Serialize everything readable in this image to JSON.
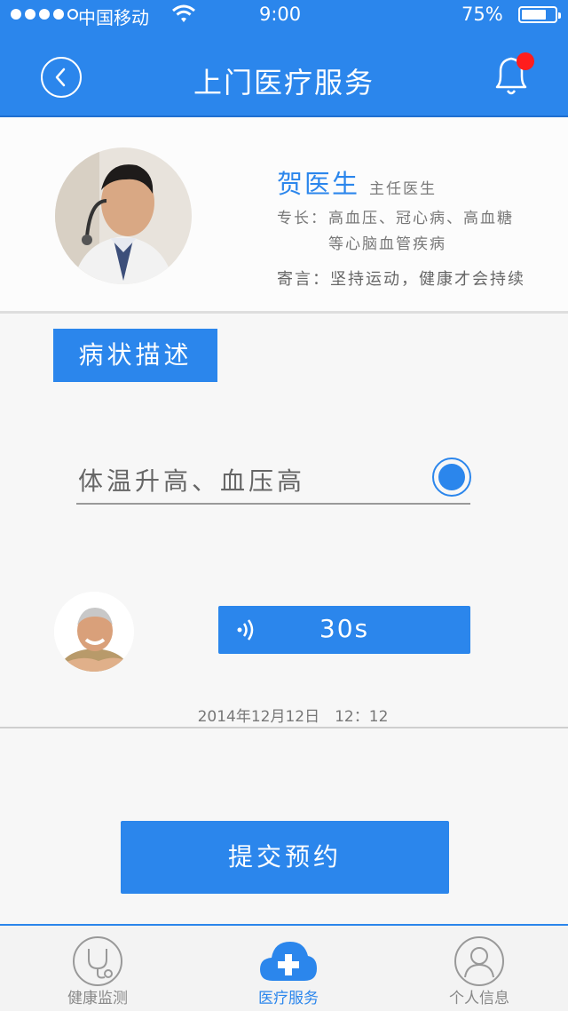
{
  "status_bar": {
    "carrier": "中国移动",
    "time": "9:00",
    "battery": "75%"
  },
  "nav": {
    "title": "上门医疗服务"
  },
  "doctor": {
    "name": "贺医生",
    "title": "主任医生",
    "specialty_label": "专长：",
    "specialty_line1": "高血压、冠心病、高血糖",
    "specialty_line2": "等心脑血管疾病",
    "message": "寄言：坚持运动，健康才会持续"
  },
  "symptoms": {
    "section_label": "病状描述",
    "text": "体温升高、血压高",
    "voice_duration": "30s",
    "timestamp": "2014年12月12日　12：12"
  },
  "submit_label": "提交预约",
  "tabs": [
    {
      "label": "健康监测",
      "icon": "stethoscope-icon"
    },
    {
      "label": "医疗服务",
      "icon": "cloud-cross-icon"
    },
    {
      "label": "个人信息",
      "icon": "person-icon"
    }
  ],
  "colors": {
    "accent": "#2b86ec",
    "notification": "#ff1d1d"
  }
}
